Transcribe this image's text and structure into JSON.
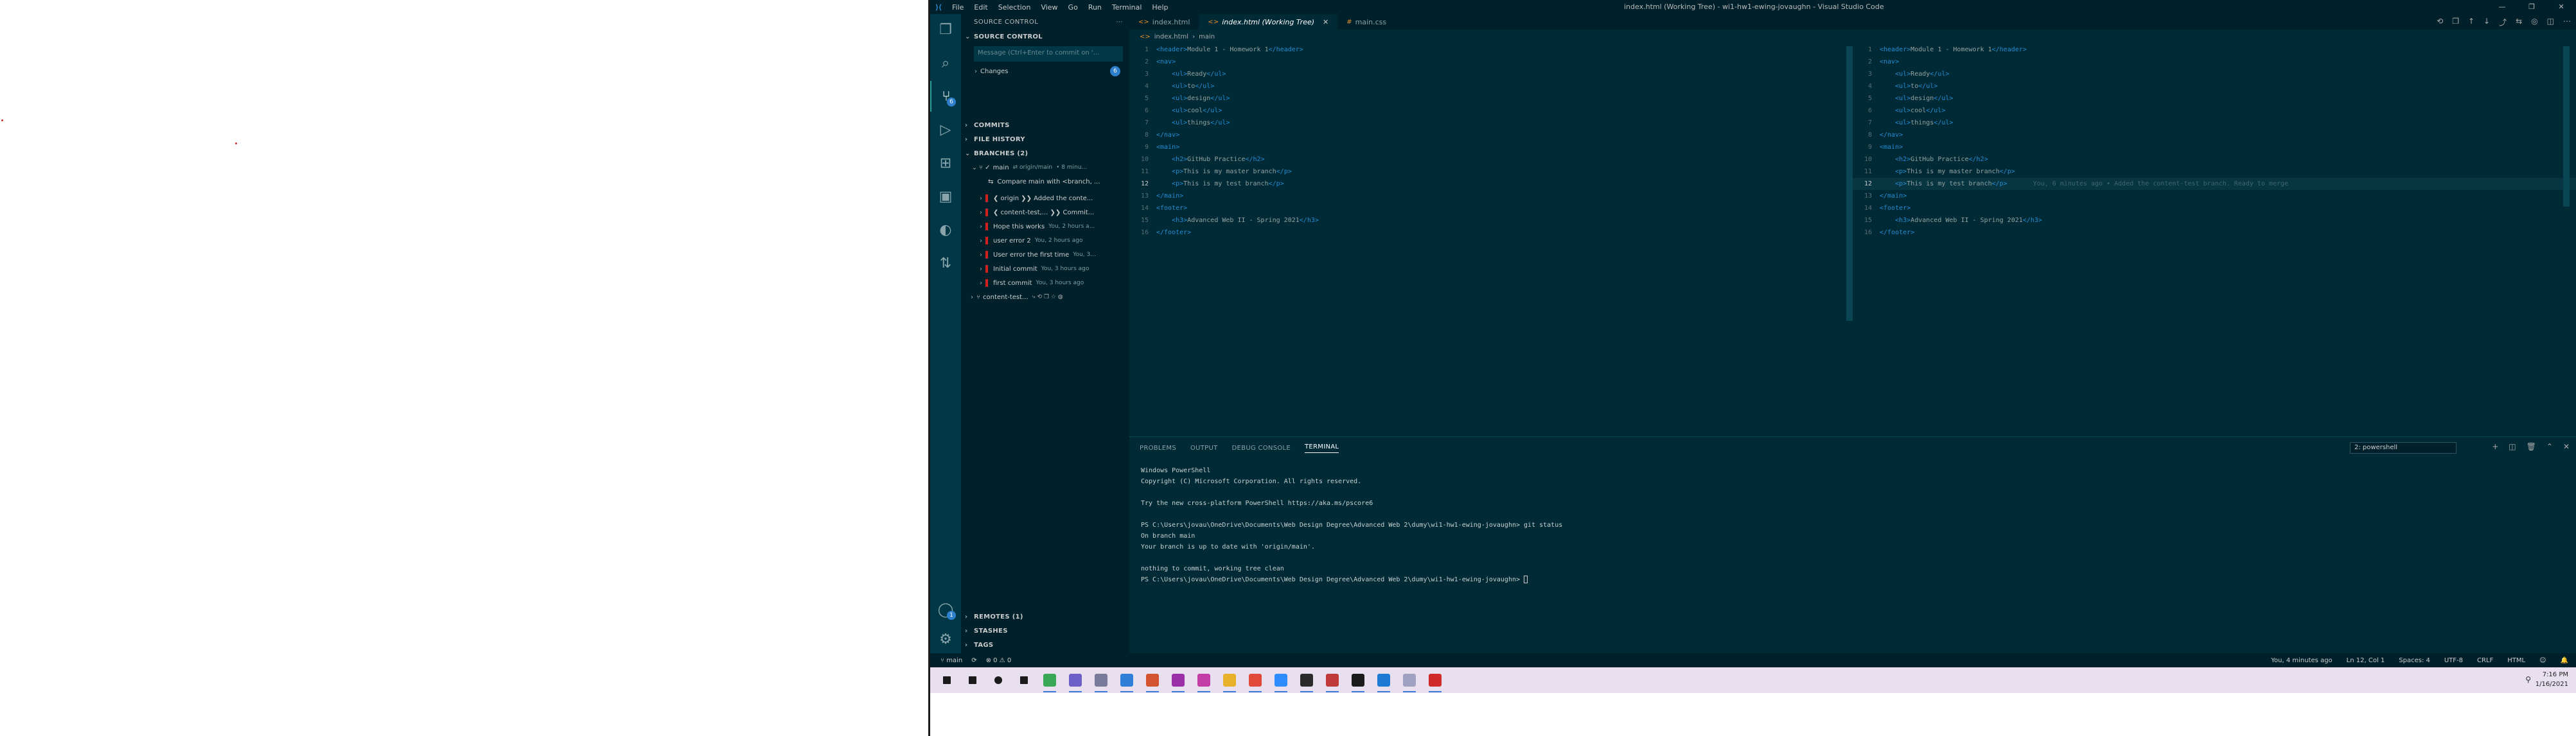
{
  "window": {
    "title": "index.html (Working Tree) - wi1-hw1-ewing-jovaughn - Visual Studio Code",
    "menu": [
      "File",
      "Edit",
      "Selection",
      "View",
      "Go",
      "Run",
      "Terminal",
      "Help"
    ],
    "controls": [
      "—",
      "❐",
      "✕"
    ]
  },
  "activity_bar": {
    "source_control_badge": "6",
    "accounts_badge": "1"
  },
  "sidebar": {
    "header": "SOURCE CONTROL",
    "header_actions": "⋯",
    "section_title": "SOURCE CONTROL",
    "commit_placeholder": "Message (Ctrl+Enter to commit on '...",
    "changes_label": "Changes",
    "changes_count": "6",
    "commits_title": "COMMITS",
    "file_history_title": "FILE HISTORY",
    "branches_title": "BRANCHES (2)",
    "branch_main": {
      "name": "main",
      "upstream": "⇄ origin/main",
      "time": "• 8 minu..."
    },
    "compare_label": "Compare main with <branch, ...",
    "commits": [
      {
        "message": "❮ origin ❯❯ Added the conte...",
        "time": ""
      },
      {
        "message": "❮ content-test,... ❯❯ Commit...",
        "time": ""
      },
      {
        "message": "Hope this works",
        "time": "You, 2 hours a..."
      },
      {
        "message": "user error 2",
        "time": "You, 2 hours ago"
      },
      {
        "message": "User error the first time",
        "time": "You, 3..."
      },
      {
        "message": "Initial commit",
        "time": "You, 3 hours ago"
      },
      {
        "message": "first commit",
        "time": "You, 3 hours ago"
      }
    ],
    "branch_content_test": "content-test...",
    "remotes_title": "REMOTES (1)",
    "stashes_title": "STASHES",
    "tags_title": "TAGS"
  },
  "editor": {
    "tabs": [
      {
        "label": "index.html",
        "icon": "<>"
      },
      {
        "label": "index.html (Working Tree)",
        "icon": "<>"
      },
      {
        "label": "main.css",
        "icon": "#"
      }
    ],
    "breadcrumb": [
      "index.html",
      "main"
    ],
    "left_lines": [
      [
        "<header>",
        "Module 1 - Homework 1",
        "</header>"
      ],
      [
        "<nav>",
        "",
        ""
      ],
      [
        "    <ul>",
        "Ready",
        "</ul>"
      ],
      [
        "    <ul>",
        "to",
        "</ul>"
      ],
      [
        "    <ul>",
        "design",
        "</ul>"
      ],
      [
        "    <ul>",
        "cool",
        "</ul>"
      ],
      [
        "    <ul>",
        "things",
        "</ul>"
      ],
      [
        "</nav>",
        "",
        ""
      ],
      [
        "<main>",
        "",
        ""
      ],
      [
        "    <h2>",
        "GitHub Practice",
        "</h2>"
      ],
      [
        "    <p>",
        "This is my master branch",
        "</p>"
      ],
      [
        "    <p>",
        "This is my test branch",
        "</p>"
      ],
      [
        "</main>",
        "",
        ""
      ],
      [
        "<footer>",
        "",
        ""
      ],
      [
        "    <h3>",
        "Advanced Web II - Spring 2021",
        "</h3>"
      ],
      [
        "</footer>",
        "",
        ""
      ]
    ],
    "right_lines": [
      [
        "<header>",
        "Module 1 - Homework 1",
        "</header>"
      ],
      [
        "<nav>",
        "",
        ""
      ],
      [
        "    <ul>",
        "Ready",
        "</ul>"
      ],
      [
        "    <ul>",
        "to",
        "</ul>"
      ],
      [
        "    <ul>",
        "design",
        "</ul>"
      ],
      [
        "    <ul>",
        "cool",
        "</ul>"
      ],
      [
        "    <ul>",
        "things",
        "</ul>"
      ],
      [
        "</nav>",
        "",
        ""
      ],
      [
        "<main>",
        "",
        ""
      ],
      [
        "    <h2>",
        "GitHub Practice",
        "</h2>"
      ],
      [
        "    <p>",
        "This is my master branch",
        "</p>"
      ],
      [
        "    <p>",
        "This is my test branch",
        "</p>"
      ],
      [
        "</main>",
        "",
        ""
      ],
      [
        "<footer>",
        "",
        ""
      ],
      [
        "    <h3>",
        "Advanced Web II - Spring 2021",
        "</h3>"
      ],
      [
        "</footer>",
        "",
        ""
      ]
    ],
    "blame_line": 12,
    "blame_text": "You, 6 minutes ago • Added the content-test branch. Ready to merge"
  },
  "panel": {
    "tabs": [
      "PROBLEMS",
      "OUTPUT",
      "DEBUG CONSOLE",
      "TERMINAL"
    ],
    "active_tab": "TERMINAL",
    "terminal_select": "2: powershell",
    "terminal_lines": [
      "Windows PowerShell",
      "Copyright (C) Microsoft Corporation. All rights reserved.",
      "",
      "Try the new cross-platform PowerShell https://aka.ms/pscore6",
      "",
      "PS C:\\Users\\jovau\\OneDrive\\Documents\\Web Design Degree\\Advanced Web 2\\dumy\\wi1-hw1-ewing-jovaughn> git status",
      "On branch main",
      "Your branch is up to date with 'origin/main'.",
      "",
      "nothing to commit, working tree clean",
      "PS C:\\Users\\jovau\\OneDrive\\Documents\\Web Design Degree\\Advanced Web 2\\dumy\\wi1-hw1-ewing-jovaughn> "
    ]
  },
  "statusbar": {
    "branch": "main",
    "sync": "⟳",
    "problems": "⊗ 0 ⚠ 0",
    "blame": "You, 4 minutes ago",
    "position": "Ln 12, Col 1",
    "spaces": "Spaces: 4",
    "encoding": "UTF-8",
    "eol": "CRLF",
    "language": "HTML"
  },
  "taskbar": {
    "time": "7:16 PM",
    "date": "1/16/2021",
    "apps": [
      {
        "name": "start-icon",
        "color": "#1a1a1a"
      },
      {
        "name": "search-icon",
        "color": "#1a1a1a"
      },
      {
        "name": "cortana-icon",
        "color": "#1a1a1a"
      },
      {
        "name": "task-view-icon",
        "color": "#1a1a1a"
      },
      {
        "name": "chrome-app-icon",
        "color": "#3aa757"
      },
      {
        "name": "discord-icon",
        "color": "#6c5fc7"
      },
      {
        "name": "onedrive-icon",
        "color": "#7a7a9a"
      },
      {
        "name": "ms-store-icon",
        "color": "#2f7ed8"
      },
      {
        "name": "ppt-icon",
        "color": "#d35230"
      },
      {
        "name": "adobe-xd-icon",
        "color": "#9a2fa8"
      },
      {
        "name": "photos-icon",
        "color": "#c43ea8"
      },
      {
        "name": "file-explorer-icon",
        "color": "#e8b12c"
      },
      {
        "name": "chrome-icon",
        "color": "#e04a3a"
      },
      {
        "name": "zoom-icon",
        "color": "#2d8cff"
      },
      {
        "name": "acrobat-icon",
        "color": "#2b2b2b"
      },
      {
        "name": "mail-icon",
        "color": "#c13a3a"
      },
      {
        "name": "terminal-icon",
        "color": "#1b1b1b"
      },
      {
        "name": "vscode-icon",
        "color": "#1f7ad4"
      },
      {
        "name": "snip-icon",
        "color": "#a0a0c0"
      },
      {
        "name": "github-icon",
        "color": "#d02a2a"
      }
    ]
  }
}
